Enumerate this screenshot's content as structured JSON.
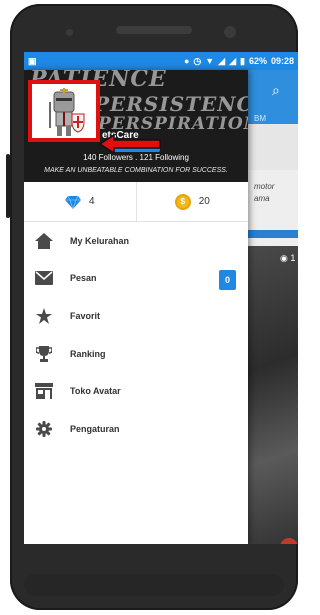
{
  "status_bar": {
    "battery": "62%",
    "time": "09:28"
  },
  "background_app": {
    "tab_partial": "BM",
    "card_text_1": "motor",
    "card_text_2": "ama",
    "views": "1"
  },
  "drawer": {
    "header": {
      "banner_line_1": "PATIENCE",
      "banner_line_2": "PERSISTENCE",
      "banner_line_3": "PERSPIRATION",
      "username": "etsCare",
      "follow_text": "140 Followers . 121 Following",
      "tagline": "MAKE AN UNBEATABLE COMBINATION FOR SUCCESS."
    },
    "stats": {
      "diamonds": "4",
      "coins": "20"
    },
    "menu": [
      {
        "label": "My Kelurahan",
        "icon": "home-icon"
      },
      {
        "label": "Pesan",
        "icon": "mail-icon",
        "badge": "0"
      },
      {
        "label": "Favorit",
        "icon": "star-icon"
      },
      {
        "label": "Ranking",
        "icon": "trophy-icon"
      },
      {
        "label": "Toko Avatar",
        "icon": "store-icon"
      },
      {
        "label": "Pengaturan",
        "icon": "gear-icon"
      }
    ]
  },
  "colors": {
    "accent": "#1e88e5",
    "highlight": "#e01010",
    "coin": "#f2b91b"
  }
}
